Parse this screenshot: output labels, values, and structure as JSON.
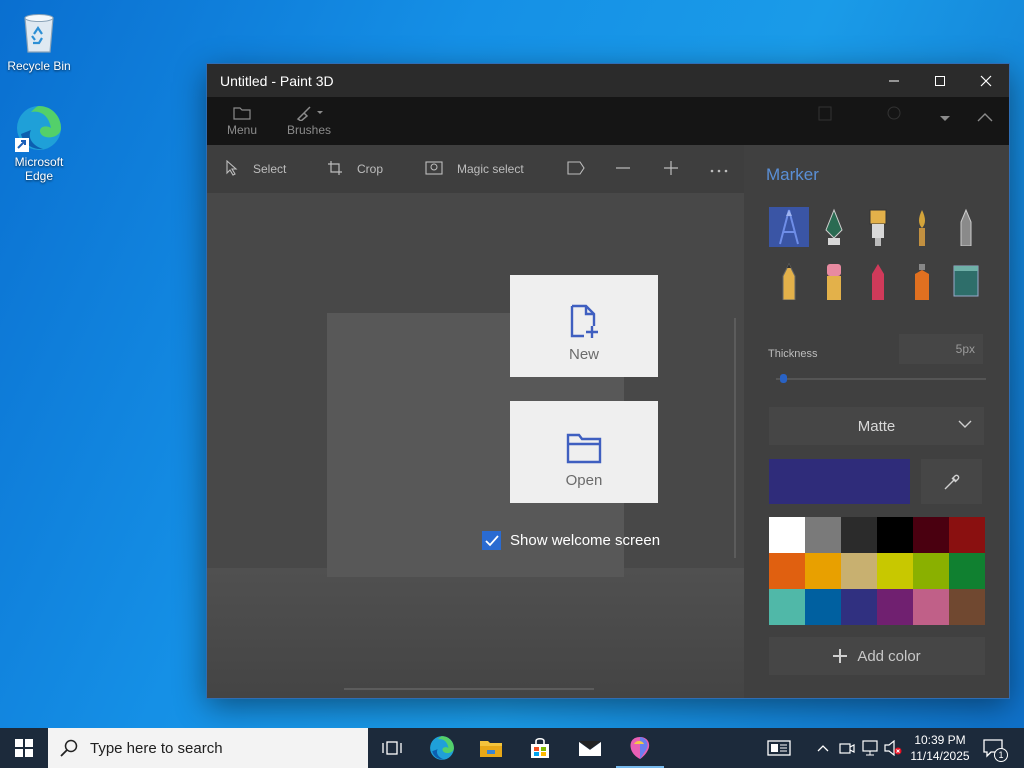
{
  "desktop": {
    "icons": [
      {
        "label": "Recycle Bin"
      },
      {
        "label": "Microsoft Edge"
      }
    ]
  },
  "window": {
    "title": "Untitled - Paint 3D",
    "ribbon": {
      "menu_label": "Menu",
      "brushes_label": "Brushes"
    },
    "toolbar": {
      "select_label": "Select",
      "crop_label": "Crop",
      "magic_select_label": "Magic select"
    },
    "welcome": {
      "new_label": "New",
      "open_label": "Open",
      "show_welcome_label": "Show welcome screen",
      "show_welcome_checked": true
    },
    "panel": {
      "title": "Marker",
      "brushes": [
        "marker-brush-icon",
        "calligraphy-pen-icon",
        "oil-brush-icon",
        "watercolor-icon",
        "pixel-pen-icon",
        "pencil-icon",
        "eraser-icon",
        "crayon-icon",
        "spray-can-icon",
        "fill-bucket-icon"
      ],
      "thickness_label": "Thickness",
      "thickness_value": "5px",
      "thickness_level_percent": 2,
      "finish_value": "Matte",
      "current_color": "#2f2c7a",
      "palette": [
        "#ffffff",
        "#7a7a7a",
        "#2b2b2b",
        "#000000",
        "#4a0010",
        "#8a1010",
        "#e06010",
        "#e8a000",
        "#c8b070",
        "#c8c800",
        "#8ab000",
        "#108030",
        "#50b8a8",
        "#0060a0",
        "#303080",
        "#702070",
        "#c06088",
        "#704830"
      ],
      "add_color_label": "Add color"
    }
  },
  "taskbar": {
    "search_placeholder": "Type here to search",
    "time": "10:39 PM",
    "date": "11/14/2025",
    "notification_count": "1"
  }
}
